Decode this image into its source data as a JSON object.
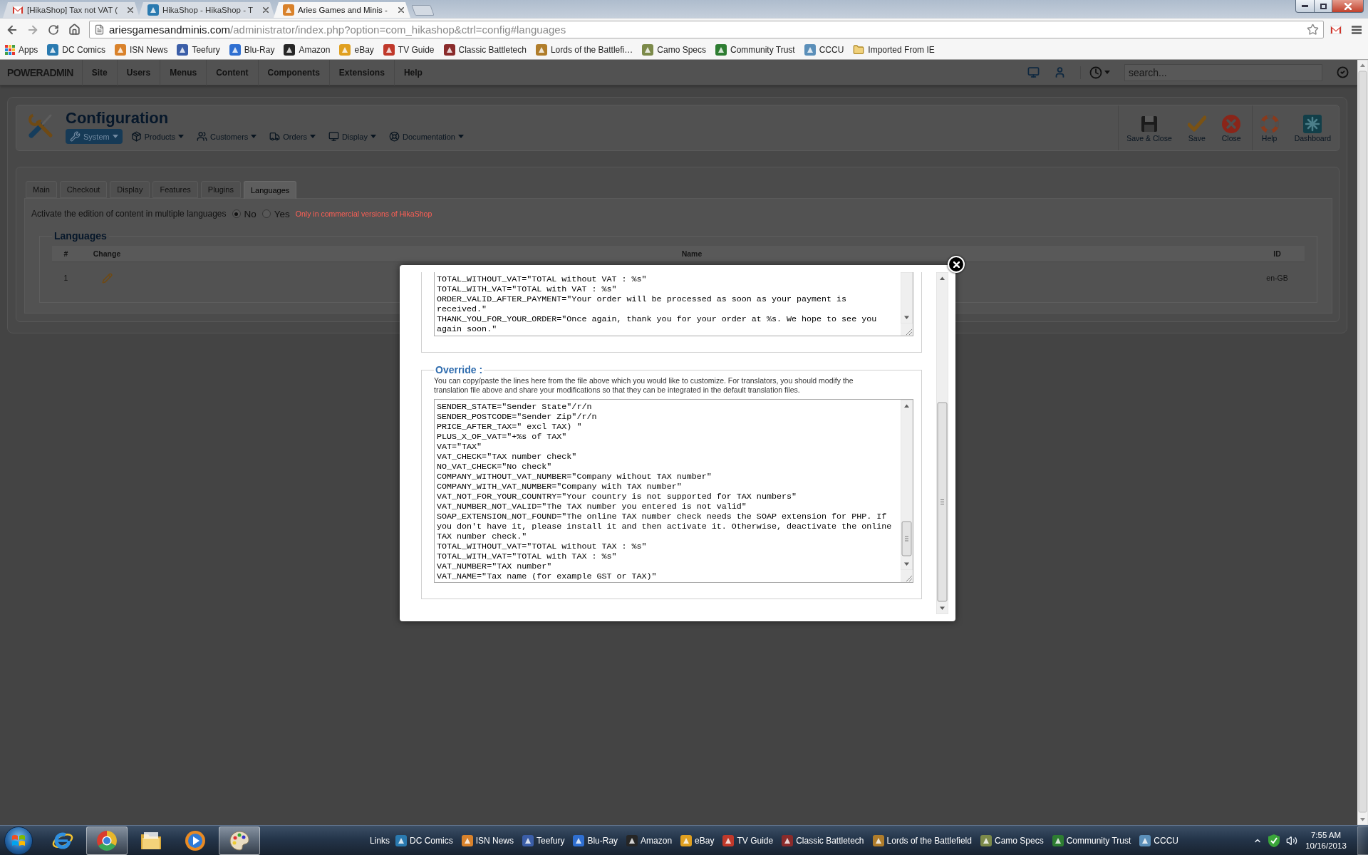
{
  "browser": {
    "tabs": [
      {
        "title": "[HikaShop] Tax not VAT (",
        "selected": false
      },
      {
        "title": "HikaShop - HikaShop - T",
        "selected": false
      },
      {
        "title": "Aries Games and Minis -",
        "selected": true
      }
    ],
    "url": "ariesgamesandminis.com/administrator/index.php?option=com_hikashop&ctrl=config#languages",
    "bookmarks": [
      {
        "label": "Apps",
        "kind": "apps"
      },
      {
        "label": "DC Comics",
        "kind": "site"
      },
      {
        "label": "ISN News",
        "kind": "site"
      },
      {
        "label": "Teefury",
        "kind": "site"
      },
      {
        "label": "Blu-Ray",
        "kind": "site"
      },
      {
        "label": "Amazon",
        "kind": "site"
      },
      {
        "label": "eBay",
        "kind": "site"
      },
      {
        "label": "TV Guide",
        "kind": "site"
      },
      {
        "label": "Classic Battletech",
        "kind": "site"
      },
      {
        "label": "Lords of the Battlefi…",
        "kind": "site"
      },
      {
        "label": "Camo Specs",
        "kind": "site"
      },
      {
        "label": "Community Trust",
        "kind": "site"
      },
      {
        "label": "CCCU",
        "kind": "site"
      },
      {
        "label": "Imported From IE",
        "kind": "folder"
      }
    ]
  },
  "admin_bar": {
    "logo": "POWERADMIN",
    "menu": [
      "Site",
      "Users",
      "Menus",
      "Content",
      "Components",
      "Extensions",
      "Help"
    ],
    "search": {
      "placeholder": "search..."
    }
  },
  "header": {
    "title": "Configuration",
    "submenu": [
      {
        "label": "System",
        "kind": "system",
        "selected": true
      },
      {
        "label": "Products",
        "kind": "products",
        "selected": false
      },
      {
        "label": "Customers",
        "kind": "customers",
        "selected": false
      },
      {
        "label": "Orders",
        "kind": "orders",
        "selected": false
      },
      {
        "label": "Display",
        "kind": "display",
        "selected": false
      },
      {
        "label": "Documentation",
        "kind": "documentation",
        "selected": false
      }
    ],
    "toolbar": [
      {
        "label": "Save & Close",
        "kind": "saveclose"
      },
      {
        "label": "Save",
        "kind": "save"
      },
      {
        "label": "Close",
        "kind": "close"
      },
      {
        "label": "Help",
        "kind": "help"
      },
      {
        "label": "Dashboard",
        "kind": "dashboard"
      }
    ]
  },
  "config_tabs": [
    {
      "label": "Main",
      "selected": false
    },
    {
      "label": "Checkout",
      "selected": false
    },
    {
      "label": "Display",
      "selected": false
    },
    {
      "label": "Features",
      "selected": false
    },
    {
      "label": "Plugins",
      "selected": false
    },
    {
      "label": "Languages",
      "selected": true
    }
  ],
  "multilanguage": {
    "label": "Activate the edition of content in multiple languages",
    "options": [
      {
        "label": "No",
        "selected": true
      },
      {
        "label": "Yes",
        "selected": false
      }
    ],
    "note": "Only in commercial versions of HikaShop"
  },
  "languages": {
    "legend": "Languages",
    "columns": [
      "#",
      "Change",
      "Name",
      "ID"
    ],
    "rows": [
      {
        "number": "1",
        "id": "en-GB"
      }
    ]
  },
  "modal": {
    "file_lines": [
      "TOTAL_WITHOUT_VAT=\"TOTAL without VAT : %s\"",
      "TOTAL_WITH_VAT=\"TOTAL with VAT : %s\"",
      "ORDER_VALID_AFTER_PAYMENT=\"Your order will be processed as soon as your payment is received.\"",
      "THANK_YOU_FOR_YOUR_ORDER=\"Once again, thank you for your order at %s. We hope to see you again soon.\""
    ],
    "override": {
      "legend": "Override :",
      "description": "You can copy/paste the lines here from the file above which you would like to customize. For translators, you should modify the translation file above and share your modifications so that they can be integrated in the default translation files.",
      "lines": [
        "SENDER_STATE=\"Sender State\"/r/n",
        "SENDER_POSTCODE=\"Sender Zip\"/r/n",
        "PRICE_AFTER_TAX=\" excl TAX) \"",
        "PLUS_X_OF_VAT=\"+%s of TAX\"",
        "VAT=\"TAX\"",
        "VAT_CHECK=\"TAX number check\"",
        "NO_VAT_CHECK=\"No check\"",
        "COMPANY_WITHOUT_VAT_NUMBER=\"Company without TAX number\"",
        "COMPANY_WITH_VAT_NUMBER=\"Company with TAX number\"",
        "VAT_NOT_FOR_YOUR_COUNTRY=\"Your country is not supported for TAX numbers\"",
        "VAT_NUMBER_NOT_VALID=\"The TAX number you entered is not valid\"",
        "SOAP_EXTENSION_NOT_FOUND=\"The online TAX number check needs the SOAP extension for PHP. If you don't have it, please install it and then activate it. Otherwise, deactivate the online TAX number check.\"",
        "TOTAL_WITHOUT_VAT=\"TOTAL without TAX : %s\"",
        "TOTAL_WITH_VAT=\"TOTAL with TAX : %s\"",
        "VAT_NUMBER=\"TAX number\"",
        "VAT_NAME=\"Tax name (for example GST or TAX)\""
      ]
    }
  },
  "taskbar": {
    "apps": [
      {
        "kind": "ie",
        "active": false
      },
      {
        "kind": "chrome",
        "active": true
      },
      {
        "kind": "folder",
        "active": false
      },
      {
        "kind": "player",
        "active": false
      },
      {
        "kind": "paint",
        "active": true
      }
    ],
    "links_label": "Links",
    "links": [
      "DC Comics",
      "ISN News",
      "Teefury",
      "Blu-Ray",
      "Amazon",
      "eBay",
      "TV Guide",
      "Classic Battletech",
      "Lords of the Battlefield",
      "Camo Specs",
      "Community Trust",
      "CCCU"
    ],
    "time": "7:55 AM",
    "date": "10/16/2013"
  }
}
